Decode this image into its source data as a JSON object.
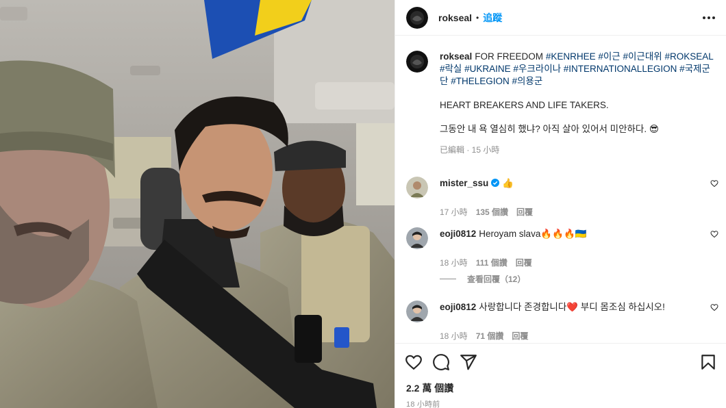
{
  "header": {
    "username": "rokseal",
    "separator": "•",
    "follow_label": "追蹤"
  },
  "caption": {
    "username": "rokseal",
    "line1_text": "FOR FREEDOM",
    "hashtags": [
      "#KENRHEE",
      "#이근",
      "#이근대위",
      "#ROKSEAL",
      "#락실",
      "#UKRAINE",
      "#우크라이나",
      "#INTERNATIONALLEGION",
      "#국제군단",
      "#THELEGION",
      "#의용군"
    ],
    "paragraph2": "HEART BREAKERS AND LIFE TAKERS.",
    "paragraph3": "그동안 내 욕 열심히 했냐? 아직 살아 있어서 미안하다. 😎",
    "meta": "已編輯 · 15 小時"
  },
  "comments": [
    {
      "username": "mister_ssu",
      "verified": true,
      "text": "👍",
      "time": "17 小時",
      "likes": "135 個讚",
      "reply_label": "回覆"
    },
    {
      "username": "eoji0812",
      "verified": false,
      "text": "Heroyam slava🔥🔥🔥🇺🇦",
      "time": "18 小時",
      "likes": "111 個讚",
      "reply_label": "回覆"
    },
    {
      "username": "eoji0812",
      "verified": false,
      "text": "사랑합니다 존경합니다❤️ 부디 몸조심 하십시오!",
      "time": "18 小時",
      "likes": "71 個讚",
      "reply_label": "回覆"
    }
  ],
  "view_replies_label": "查看回覆（12）",
  "actions": {
    "icons": [
      "heart-icon",
      "comment-icon",
      "share-icon",
      "bookmark-icon"
    ]
  },
  "likes_count": "2.2 萬 個讚",
  "timestamp": "18 小時前",
  "colors": {
    "link_blue": "#0095f6",
    "hashtag": "#00376b",
    "muted": "#8e8e8e",
    "verified": "#0095f6",
    "flag_blue": "#1c4fb3",
    "flag_yellow": "#f2cf1b"
  }
}
